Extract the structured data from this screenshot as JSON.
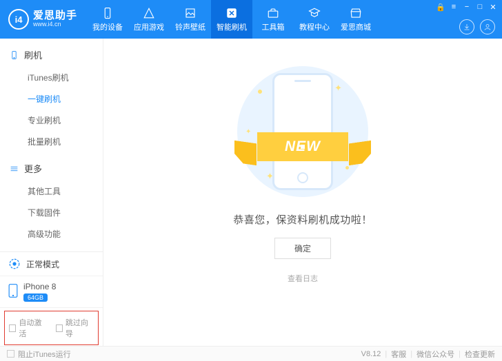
{
  "logo": {
    "badge": "i4",
    "brand": "爱思助手",
    "site": "www.i4.cn"
  },
  "nav": {
    "device": "我的设备",
    "apps": "应用游戏",
    "ring": "铃声壁纸",
    "flash": "智能刷机",
    "toolbox": "工具箱",
    "tutorial": "教程中心",
    "store": "爱思商城"
  },
  "sidebar": {
    "group_flash": "刷机",
    "items_flash": {
      "itunes": "iTunes刷机",
      "oneclick": "一键刷机",
      "pro": "专业刷机",
      "batch": "批量刷机"
    },
    "group_more": "更多",
    "items_more": {
      "other": "其他工具",
      "firmware": "下载固件",
      "advanced": "高级功能"
    },
    "mode": "正常模式",
    "device_name": "iPhone 8",
    "capacity": "64GB",
    "auto_activate": "自动激活",
    "skip_guide": "跳过向导"
  },
  "main": {
    "ribbon": "NEW",
    "message": "恭喜您，保资料刷机成功啦！",
    "ok": "确定",
    "viewlog": "查看日志"
  },
  "status": {
    "block_itunes": "阻止iTunes运行",
    "version": "V8.12",
    "cs": "客服",
    "wechat": "微信公众号",
    "update": "检查更新"
  }
}
